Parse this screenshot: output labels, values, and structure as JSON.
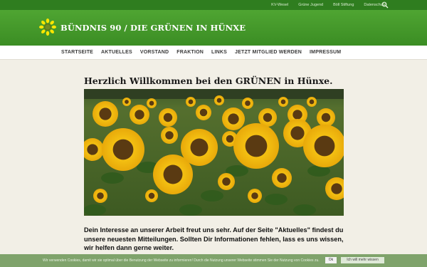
{
  "topbar": {
    "links": [
      "KV-Wesel",
      "Grüne Jugend",
      "Böll Stiftung",
      "Datenschutz"
    ],
    "search_icon": "search-icon"
  },
  "header": {
    "site_title": "BÜNDNIS 90 / DIE GRÜNEN IN HÜNXE",
    "logo_icon": "sunflower-icon"
  },
  "nav": {
    "items": [
      "STARTSEITE",
      "AKTUELLES",
      "VORSTAND",
      "FRAKTION",
      "LINKS",
      "JETZT MITGLIED WERDEN",
      "IMPRESSUM"
    ]
  },
  "main": {
    "headline": "Herzlich Willkommen bei den GRÜNEN in Hünxe.",
    "intro": "Dein Interesse an unserer Arbeit freut uns sehr. Auf der Seite \"Aktuelles\" findest du unsere neuesten Mitteilungen. Sollten Dir Informationen fehlen, lass es uns wissen, wir helfen dann gerne weiter."
  },
  "cookie_bar": {
    "text": "Wir verwenden Cookies, damit wir sie optimal über die Benutzung der Webseite zu informieren! Durch die Nutzung unserer Webseite stimmen Sie der Nutzung von Cookies zu.",
    "ok_label": "Ok",
    "more_label": "Ich will mehr wissen"
  },
  "colors": {
    "topbar": "#2f7d1f",
    "banner": "#4fa532",
    "cookie_bar": "#7fa36b",
    "background": "#f2efe6"
  }
}
